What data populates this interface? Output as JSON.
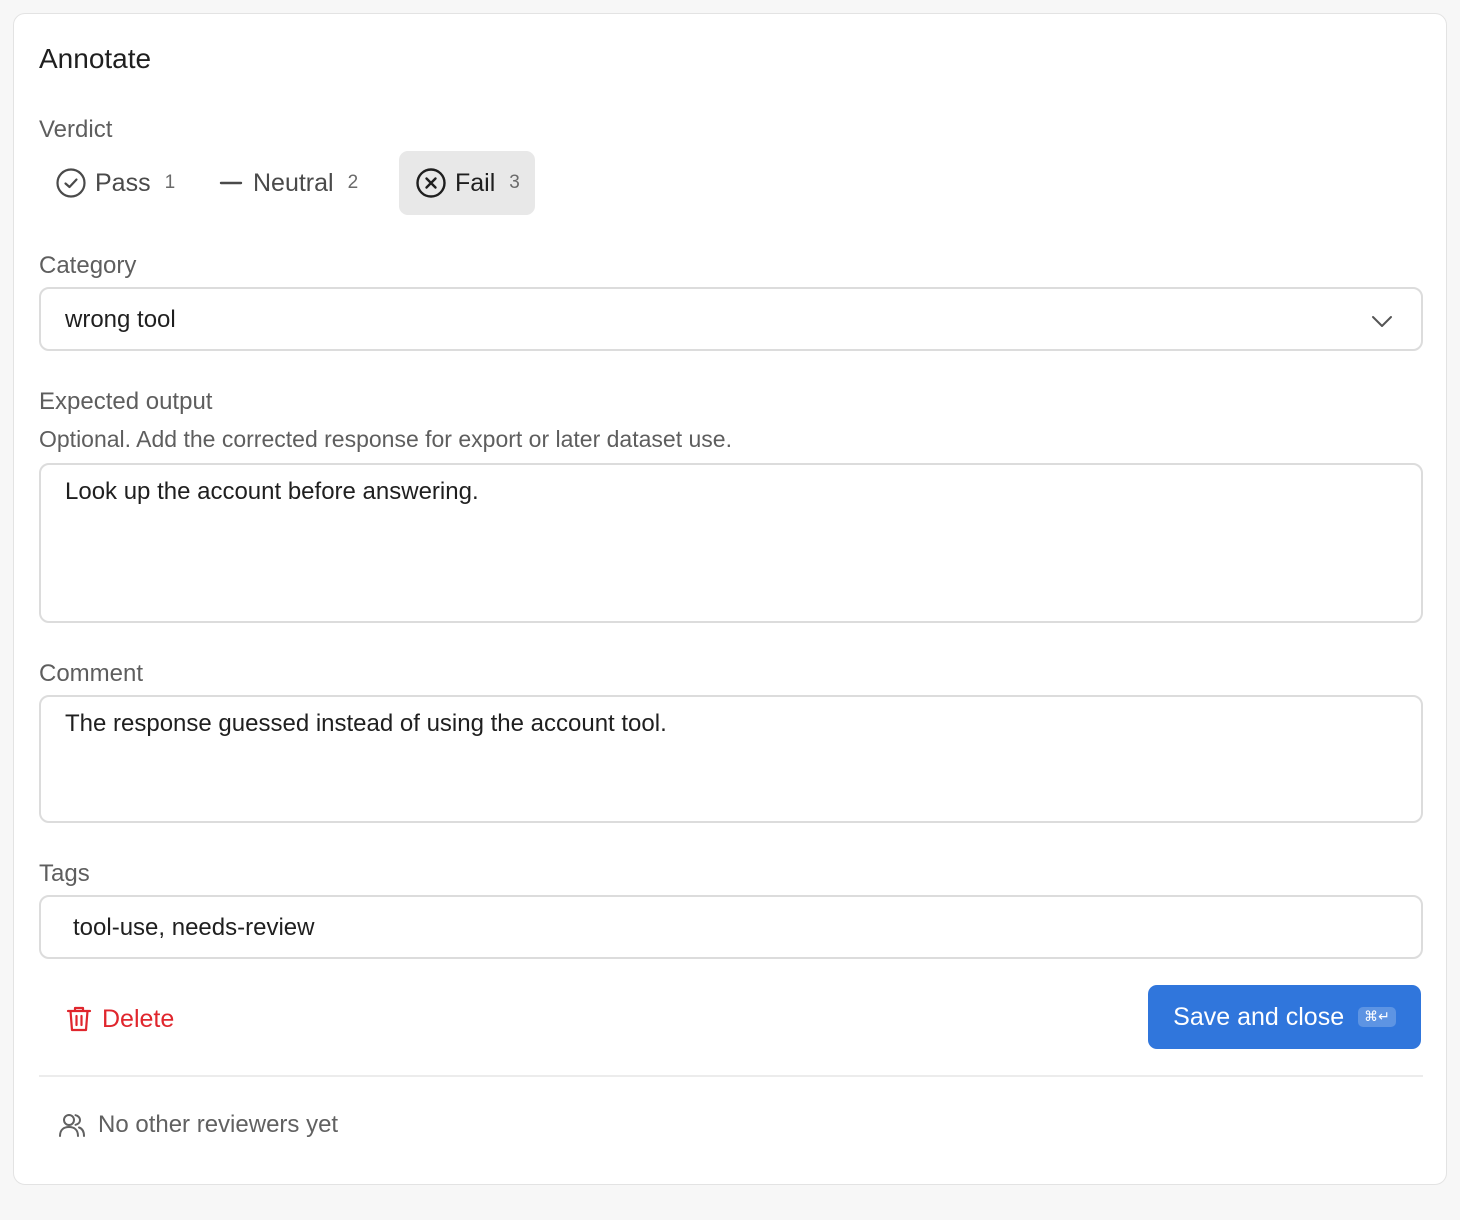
{
  "panel": {
    "title": "Annotate"
  },
  "verdict": {
    "label": "Verdict",
    "options": [
      {
        "label": "Pass",
        "key": "1",
        "icon": "check-circle-icon",
        "selected": false
      },
      {
        "label": "Neutral",
        "key": "2",
        "icon": "minus-icon",
        "selected": false
      },
      {
        "label": "Fail",
        "key": "3",
        "icon": "x-circle-icon",
        "selected": true
      }
    ]
  },
  "category": {
    "label": "Category",
    "value": "wrong tool",
    "icon": "chevron-down-icon"
  },
  "expected_output": {
    "label": "Expected output",
    "hint": "Optional. Add the corrected response for export or later dataset use.",
    "value": "Look up the account before answering."
  },
  "comment": {
    "label": "Comment",
    "value": "The response guessed instead of using the account tool."
  },
  "tags": {
    "label": "Tags",
    "value": "tool-use, needs-review"
  },
  "actions": {
    "delete_label": "Delete",
    "delete_icon": "trash-icon",
    "save_label": "Save and close",
    "save_shortcut": "⌘↵"
  },
  "reviewers": {
    "text": "No other reviewers yet",
    "icon": "users-icon"
  },
  "colors": {
    "accent": "#3076dc",
    "danger": "#e0262d",
    "selected_bg": "#e8e8e8"
  }
}
